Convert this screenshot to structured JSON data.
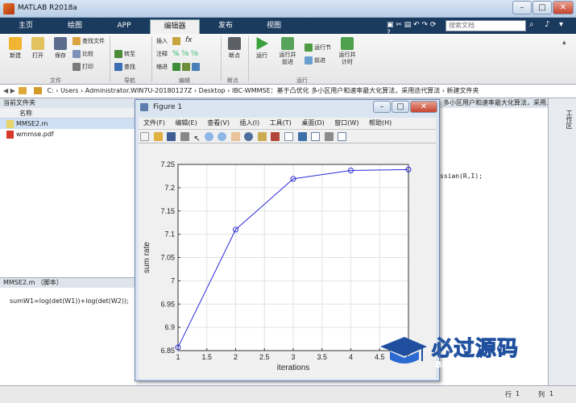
{
  "window": {
    "title": "MATLAB R2018a"
  },
  "tabs": [
    "主页",
    "绘图",
    "APP",
    "编辑器",
    "发布",
    "视图"
  ],
  "active_tab": "编辑器",
  "search": {
    "placeholder": "搜索文档"
  },
  "ribbon": {
    "file": {
      "new": "新建",
      "open": "打开",
      "save": "保存",
      "find_files": "查找文件",
      "compare": "比较",
      "print": "打印",
      "group": "文件"
    },
    "nav": {
      "goto": "转至",
      "find": "查找",
      "group": "导航"
    },
    "edit": {
      "insert": "插入",
      "comment": "注释",
      "indent": "缩进",
      "fx": "fx",
      "group": "编辑"
    },
    "breakpoints": {
      "label": "断点",
      "group": "断点"
    },
    "run": {
      "run": "运行",
      "run_advance": "运行并\n前进",
      "run_section": "运行节",
      "advance": "前进",
      "run_time": "运行并\n计时",
      "group": "运行"
    }
  },
  "address": {
    "path": "C: › Users › Administrator.WIN7U-20180127Z › Desktop › IBC-WMMSE：基于凸优化 多小区用户和速率最大化算法，采用迭代算法 › 新建文件夹"
  },
  "current_folder": {
    "title": "当前文件夹",
    "col_name": "名称",
    "files": [
      "MMSE2.m",
      "wmmse.pdf"
    ]
  },
  "details": {
    "title": "MMSE2.m （脚本）",
    "code": "sumW1=log(det(W1))+log(det(W2));"
  },
  "editor": {
    "header": "多小区用户和速率最大化算法，采用...",
    "snippet": "ssian(R,I);"
  },
  "right_panel": {
    "label": "工作区"
  },
  "status": {
    "row_label": "行",
    "row": "1",
    "col_label": "列",
    "col": "1"
  },
  "figure": {
    "title": "Figure 1",
    "menu": [
      "文件(F)",
      "编辑(E)",
      "查看(V)",
      "插入(I)",
      "工具(T)",
      "桌面(D)",
      "窗口(W)",
      "帮助(H)"
    ]
  },
  "chart_data": {
    "type": "line",
    "x": [
      1,
      2,
      3,
      4,
      5
    ],
    "y": [
      6.857,
      7.11,
      7.219,
      7.237,
      7.239
    ],
    "xlabel": "iterations",
    "ylabel": "sum rate",
    "xlim": [
      1,
      5
    ],
    "ylim": [
      6.85,
      7.25
    ],
    "xticks": [
      "1",
      "1.5",
      "2",
      "2.5",
      "3",
      "3.5",
      "4",
      "4.5",
      "5"
    ],
    "yticks": [
      "6.85",
      "6.9",
      "6.95",
      "7",
      "7.05",
      "7.1",
      "7.15",
      "7.2",
      "7.25"
    ],
    "grid": true,
    "marker": "circle",
    "color": "#2a2ad8"
  },
  "watermark": {
    "text": "必过源码",
    "sub": "Biguo100.com"
  }
}
